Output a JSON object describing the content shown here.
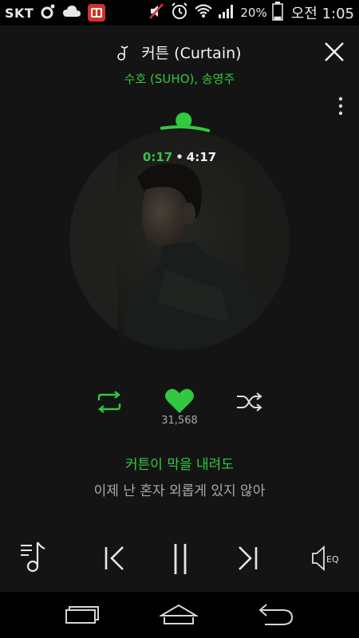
{
  "status_bar": {
    "carrier": "SKT",
    "battery_percent": "20%",
    "time": "오전 1:05",
    "battery_level": 0.2
  },
  "now_playing": {
    "title": "커튼 (Curtain)",
    "artist": "수호 (SUHO), 송영주",
    "time_current": "0:17",
    "time_total": "4:17",
    "progress": 0.066,
    "like_count": "31,568",
    "liked": true
  },
  "lyrics": {
    "current": "커튼이 막을 내려도",
    "next": "이제 난 혼자 외롭게 있지 않아"
  },
  "icons": {
    "title_note": "music-note-icon",
    "close": "close-icon",
    "more": "more-vert-icon",
    "repeat": "repeat-icon",
    "like": "heart-icon",
    "shuffle": "shuffle-icon",
    "playlist": "playlist-icon",
    "prev": "previous-icon",
    "pause": "pause-icon",
    "next": "next-icon",
    "eq": "equalizer-icon",
    "eq_label": "EQ"
  },
  "colors": {
    "accent": "#32c841",
    "background": "#141414",
    "lyric_dim": "#a8a8a8"
  }
}
